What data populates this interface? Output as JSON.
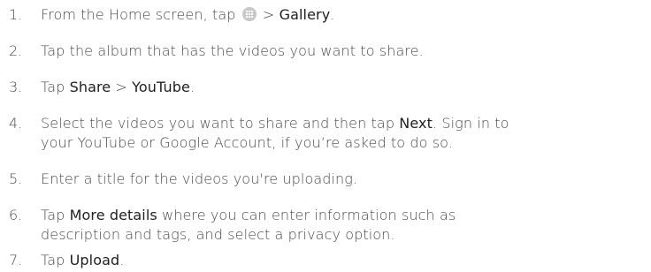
{
  "steps": [
    {
      "number": "1.",
      "parts": {
        "a": "From the Home screen, tap ",
        "icon": "apps-icon",
        "b": " > ",
        "ui1": "Gallery",
        "c": "."
      }
    },
    {
      "number": "2.",
      "parts": {
        "a": "Tap the album that has the videos you want to share."
      }
    },
    {
      "number": "3.",
      "parts": {
        "a": "Tap ",
        "ui1": "Share",
        "b": " > ",
        "ui2": "YouTube",
        "c": "."
      }
    },
    {
      "number": "4.",
      "parts": {
        "a": "Select the videos you want to share and then tap ",
        "ui1": "Next",
        "b": ". Sign in to",
        "line2": "your YouTube or Google Account, if you’re asked to do so."
      }
    },
    {
      "number": "5.",
      "parts": {
        "a": "Enter a title for the videos you're uploading."
      }
    },
    {
      "number": "6.",
      "parts": {
        "a": "Tap ",
        "ui1": "More details",
        "b": " where you can enter information such as",
        "line2": "description and tags, and select a privacy option."
      }
    },
    {
      "number": "7.",
      "parts": {
        "a": "Tap ",
        "ui1": "Upload",
        "b": "."
      }
    }
  ],
  "colors": {
    "text": "#4a4a4a",
    "ui_term": "#1f1f1f",
    "icon_bg": "#cfcfcf"
  }
}
